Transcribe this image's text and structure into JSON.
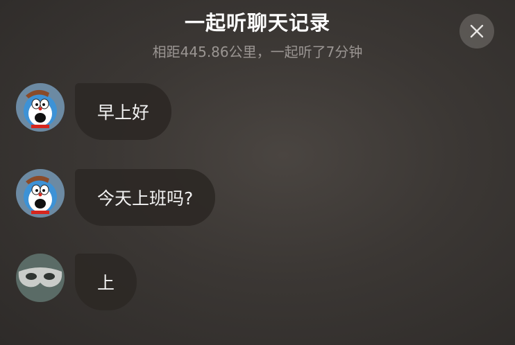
{
  "header": {
    "title": "一起听聊天记录",
    "subtitle": "相距445.86公里，一起听了7分钟"
  },
  "close_icon": "close-icon",
  "messages": [
    {
      "avatar": "doraemon-avatar",
      "text": "早上好"
    },
    {
      "avatar": "doraemon-avatar",
      "text": "今天上班吗?"
    },
    {
      "avatar": "mask-avatar",
      "text": "上"
    }
  ]
}
